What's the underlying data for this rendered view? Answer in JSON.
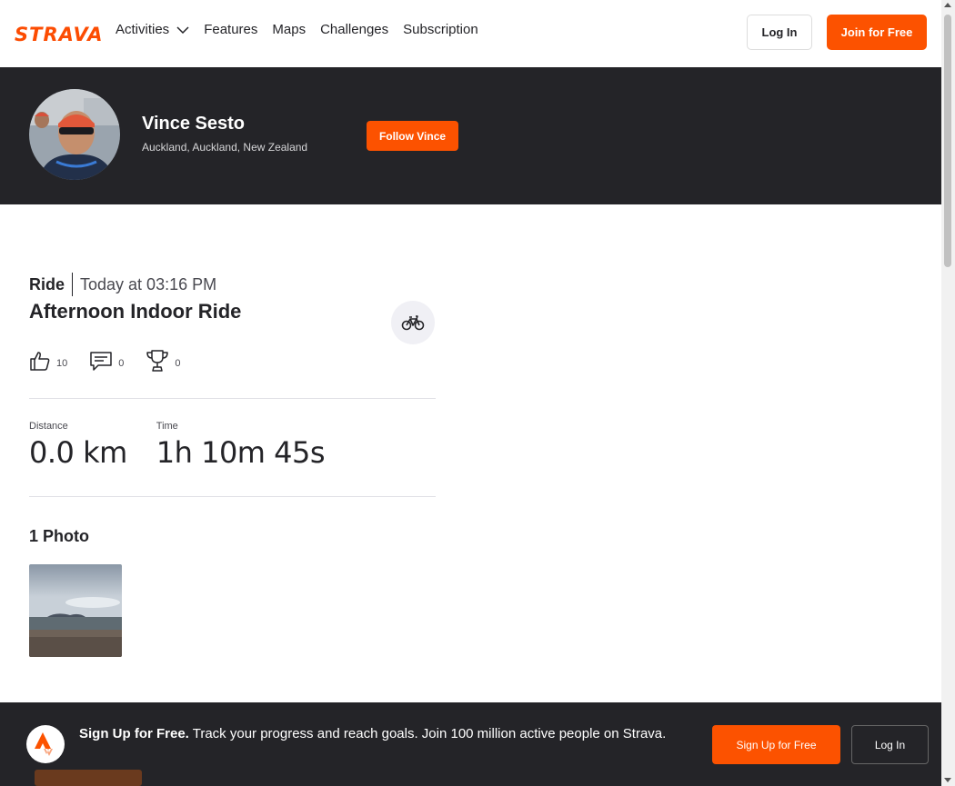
{
  "brand": {
    "logo_text": "STRAVA",
    "accent": "#fc5200"
  },
  "nav": {
    "items": [
      {
        "label": "Activities",
        "has_dropdown": true
      },
      {
        "label": "Features"
      },
      {
        "label": "Maps"
      },
      {
        "label": "Challenges"
      },
      {
        "label": "Subscription"
      }
    ],
    "login_label": "Log In",
    "join_label": "Join for Free"
  },
  "athlete": {
    "name": "Vince Sesto",
    "location": "Auckland, Auckland, New Zealand",
    "follow_label": "Follow Vince"
  },
  "activity": {
    "type": "Ride",
    "date": "Today at 03:16 PM",
    "title": "Afternoon Indoor Ride",
    "sport_icon": "bike-icon",
    "kudos": "10",
    "comments": "0",
    "achievements": "0",
    "stats": [
      {
        "label": "Distance",
        "value": "0.0 km"
      },
      {
        "label": "Time",
        "value": "1h 10m 45s"
      }
    ],
    "photos_heading": "1 Photo"
  },
  "signup_bar": {
    "bold": "Sign Up for Free.",
    "text": " Track your progress and reach goals. Join 100 million active people on Strava.",
    "signup_label": "Sign Up for Free",
    "login_label": "Log In"
  }
}
